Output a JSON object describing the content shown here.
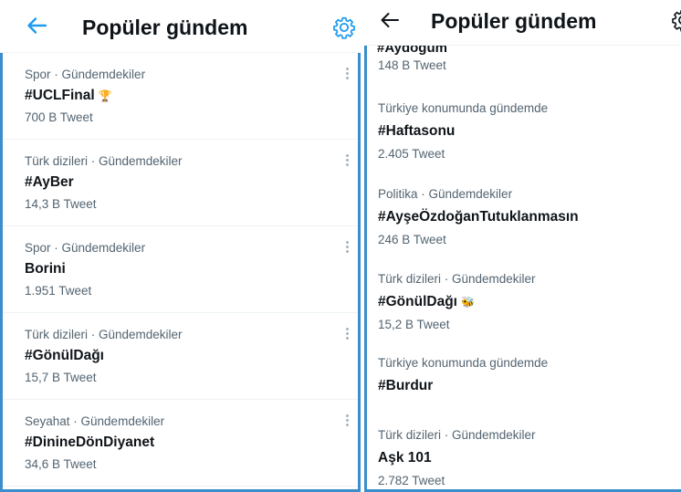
{
  "left": {
    "title": "Popüler gündem",
    "items": [
      {
        "meta": "Spor · Gündemdekiler",
        "name": "#UCLFinal",
        "emoji": "🏆",
        "count": "700 B Tweet"
      },
      {
        "meta": "Türk dizileri · Gündemdekiler",
        "name": "#AyBer",
        "emoji": "",
        "count": "14,3 B Tweet"
      },
      {
        "meta": "Spor · Gündemdekiler",
        "name": "Borini",
        "emoji": "",
        "count": "1.951 Tweet"
      },
      {
        "meta": "Türk dizileri · Gündemdekiler",
        "name": "#GönülDağı",
        "emoji": "",
        "count": "15,7 B Tweet"
      },
      {
        "meta": "Seyahat · Gündemdekiler",
        "name": "#DinineDönDiyanet",
        "emoji": "",
        "count": "34,6 B Tweet"
      }
    ]
  },
  "right": {
    "title": "Popüler gündem",
    "partial": {
      "name": "#Aydoğum",
      "count": "148 B Tweet"
    },
    "items": [
      {
        "meta": "Türkiye konumunda gündemde",
        "name": "#Haftasonu",
        "emoji": "",
        "count": "2.405 Tweet"
      },
      {
        "meta": "Politika · Gündemdekiler",
        "name": "#AyşeÖzdoğanTutuklanmasın",
        "emoji": "",
        "count": "246 B Tweet"
      },
      {
        "meta": "Türk dizileri · Gündemdekiler",
        "name": "#GönülDağı",
        "emoji": "🐝",
        "count": "15,2 B Tweet"
      },
      {
        "meta": "Türkiye konumunda gündemde",
        "name": "#Burdur",
        "emoji": "",
        "count": ""
      },
      {
        "meta": "Türk dizileri · Gündemdekiler",
        "name": "Aşk 101",
        "emoji": "",
        "count": "2.782 Tweet"
      }
    ]
  },
  "icons": {
    "back": "arrow-left-icon",
    "settings": "gear-icon",
    "more": "more-vertical-icon"
  },
  "colors": {
    "accent": "#1d9bf0",
    "frame": "#3a8ecb",
    "muted": "#536471",
    "text": "#0f1419"
  }
}
